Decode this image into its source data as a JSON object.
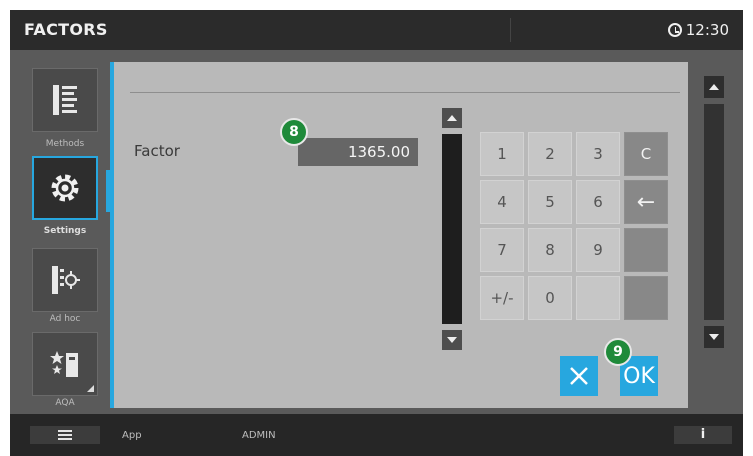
{
  "header": {
    "title": "FACTORS",
    "time": "12:30"
  },
  "nav": {
    "items": [
      {
        "label": "Methods",
        "icon": "methods-list-icon"
      },
      {
        "label": "Settings",
        "icon": "settings-gear-icon",
        "selected": true
      },
      {
        "label": "Ad hoc",
        "icon": "ad-hoc-icon"
      },
      {
        "label": "AQA",
        "icon": "aqa-stars-icon"
      }
    ]
  },
  "form": {
    "factor_label": "Factor",
    "factor_value": "1365.00"
  },
  "keypad": {
    "keys": [
      "1",
      "2",
      "3",
      "C",
      "4",
      "5",
      "6",
      "←",
      "7",
      "8",
      "9",
      "",
      "+/-",
      "0",
      "",
      ""
    ]
  },
  "actions": {
    "cancel_icon": "close-x-icon",
    "ok_label": "OK"
  },
  "badges": {
    "field_callout": "8",
    "ok_callout": "9"
  },
  "footer": {
    "app_label": "App",
    "user_label": "ADMIN",
    "info_label": "i"
  },
  "colors": {
    "accent": "#27a7df",
    "badge": "#1f8a3a",
    "topbar": "#2b2b2b",
    "panel": "#b9b9b9"
  }
}
